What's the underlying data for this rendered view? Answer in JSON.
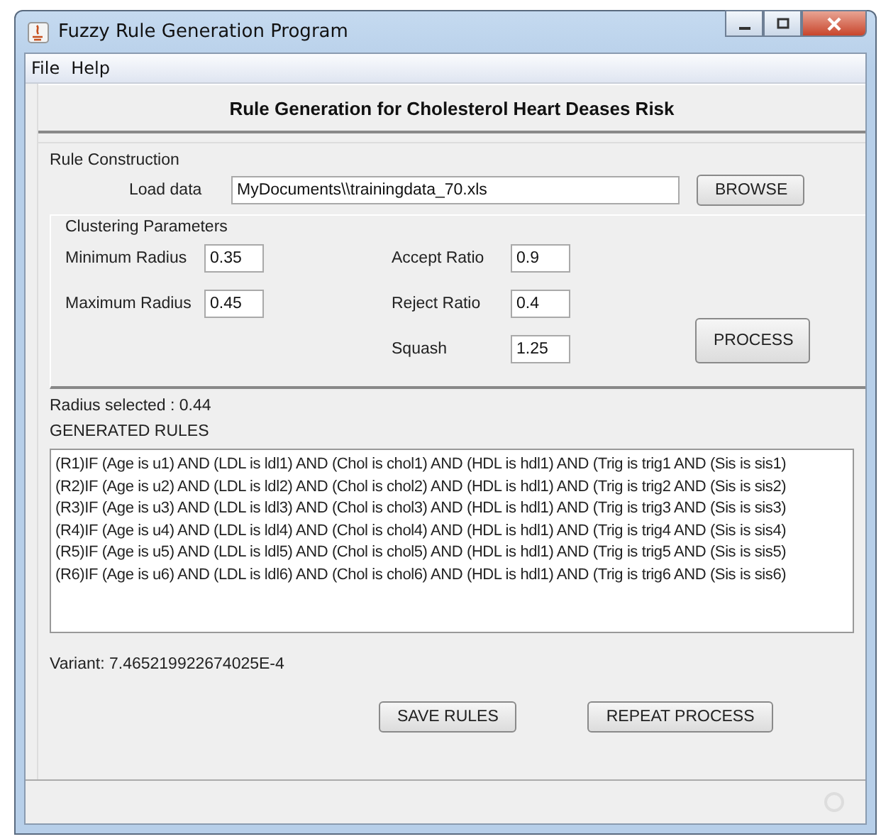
{
  "window": {
    "title": "Fuzzy Rule Generation Program"
  },
  "menu": [
    "File",
    "Help"
  ],
  "heading": "Rule Generation for Cholesterol Heart Deases Risk",
  "rule_construction": {
    "title": "Rule Construction",
    "load_label": "Load data",
    "load_value": "MyDocuments\\\\trainingdata_70.xls",
    "browse_button": "BROWSE"
  },
  "clustering": {
    "title": "Clustering Parameters",
    "left": [
      {
        "label": "Minimum Radius",
        "value": "0.35"
      },
      {
        "label": "Maximum Radius",
        "value": "0.45"
      }
    ],
    "right": [
      {
        "label": "Accept Ratio",
        "value": "0.9"
      },
      {
        "label": "Reject Ratio",
        "value": "0.4"
      },
      {
        "label": "Squash",
        "value": "1.25"
      }
    ],
    "process_button": "PROCESS"
  },
  "radius_selected": "Radius selected : 0.44",
  "rules_title": "GENERATED RULES",
  "rules": [
    "(R1)IF (Age is u1) AND (LDL is ldl1) AND (Chol is chol1) AND (HDL is hdl1) AND (Trig is trig1 AND (Sis is sis1)",
    "(R2)IF (Age is u2) AND (LDL is ldl2) AND (Chol is chol2) AND (HDL is hdl1) AND (Trig is trig2 AND (Sis is sis2)",
    "(R3)IF (Age is u3) AND (LDL is ldl3) AND (Chol is chol3) AND (HDL is hdl1) AND (Trig is trig3 AND (Sis is sis3)",
    "(R4)IF (Age is u4) AND (LDL is ldl4) AND (Chol is chol4) AND (HDL is hdl1) AND (Trig is trig4 AND (Sis is sis4)",
    "(R5)IF (Age is u5) AND (LDL is ldl5) AND (Chol is chol5) AND (HDL is hdl1) AND (Trig is trig5 AND (Sis is sis5)",
    "(R6)IF (Age is u6) AND (LDL is ldl6) AND (Chol is chol6) AND (HDL is hdl1) AND (Trig is trig6 AND (Sis is sis6)"
  ],
  "variant": "Variant: 7.465219922674025E-4",
  "buttons": [
    "SAVE RULES",
    "REPEAT PROCESS"
  ]
}
